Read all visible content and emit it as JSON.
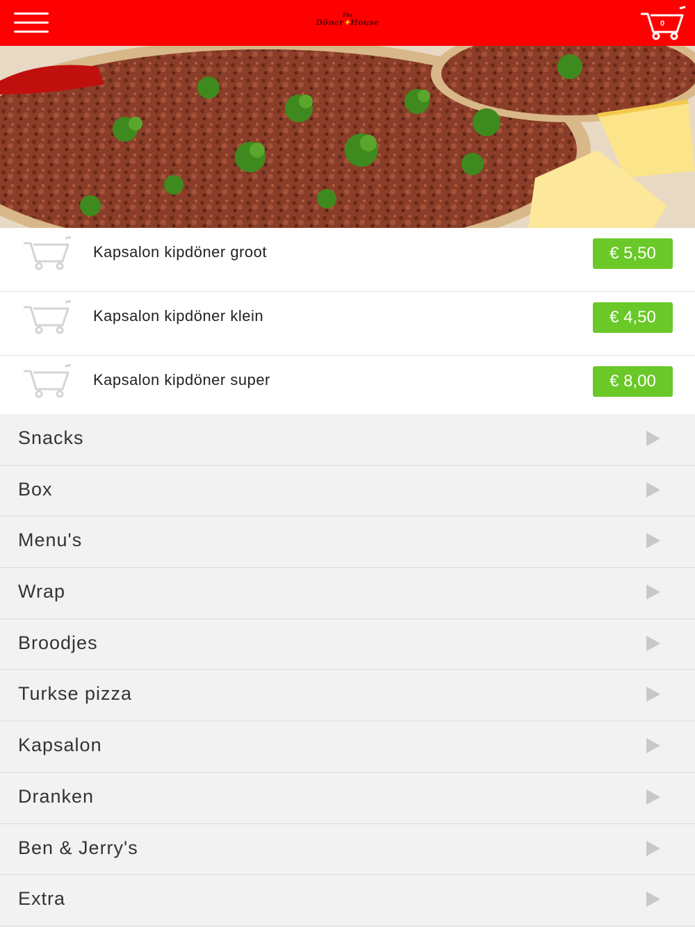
{
  "header": {
    "logo_small": "The",
    "logo_main_left": "Döner",
    "logo_main_right": "House",
    "cart_count": "0",
    "background": "#ff0000"
  },
  "products": [
    {
      "name": "Kapsalon kipdöner groot",
      "price": "€ 5,50"
    },
    {
      "name": "Kapsalon kipdöner klein",
      "price": "€ 4,50"
    },
    {
      "name": "Kapsalon kipdöner super",
      "price": "€ 8,00"
    }
  ],
  "categories": [
    {
      "label": "Snacks"
    },
    {
      "label": "Box"
    },
    {
      "label": "Menu's"
    },
    {
      "label": "Wrap"
    },
    {
      "label": "Broodjes"
    },
    {
      "label": "Turkse pizza"
    },
    {
      "label": "Kapsalon"
    },
    {
      "label": "Dranken"
    },
    {
      "label": "Ben & Jerry's"
    },
    {
      "label": "Extra"
    }
  ],
  "colors": {
    "accent": "#ff0000",
    "price_button": "#6ac828",
    "background": "#f2f2f2"
  },
  "icons": {
    "menu": "hamburger-menu-icon",
    "cart": "shopping-cart-icon",
    "add_to_cart": "cart-outline-icon",
    "chevron": "triangle-right-icon"
  }
}
